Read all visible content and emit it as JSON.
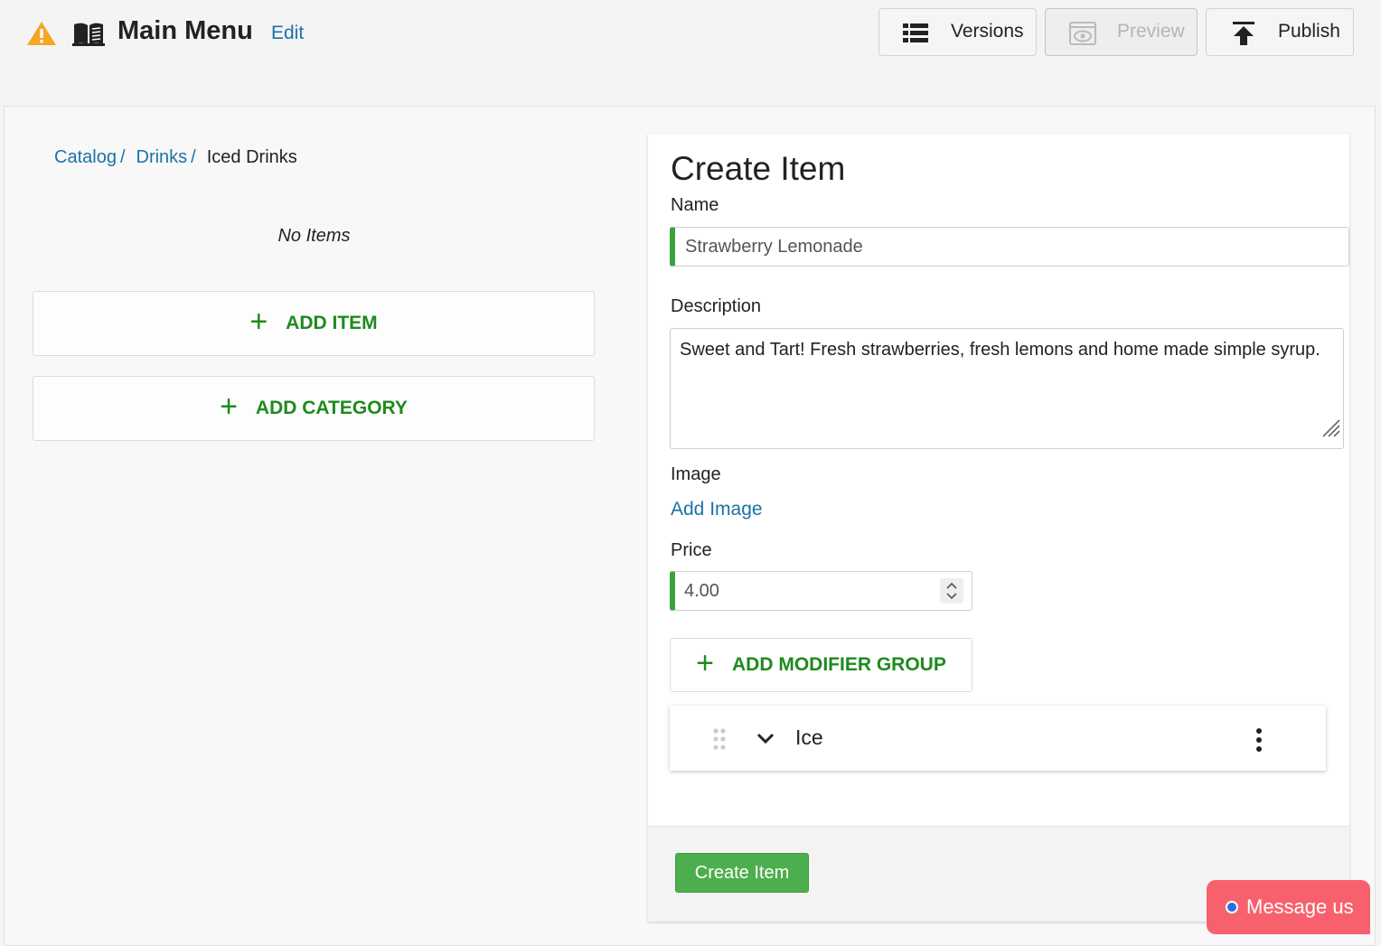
{
  "header": {
    "title": "Main Menu",
    "edit_label": "Edit",
    "versions_label": "Versions",
    "preview_label": "Preview",
    "publish_label": "Publish"
  },
  "breadcrumb": {
    "items": [
      "Catalog",
      "Drinks"
    ],
    "separator": "/",
    "current": "Iced Drinks"
  },
  "left_panel": {
    "empty_text": "No Items",
    "add_item_label": "ADD ITEM",
    "add_category_label": "ADD CATEGORY"
  },
  "form": {
    "title": "Create Item",
    "name_label": "Name",
    "name_value": "Strawberry Lemonade",
    "description_label": "Description",
    "description_value": "Sweet and Tart! Fresh strawberries, fresh lemons and home made simple syrup.",
    "image_label": "Image",
    "add_image_label": "Add Image",
    "price_label": "Price",
    "price_value": "4.00",
    "add_modifier_group_label": "ADD MODIFIER GROUP",
    "modifier_groups": [
      {
        "name": "Ice"
      }
    ],
    "submit_label": "Create Item"
  },
  "chat_widget": {
    "label": "Message us"
  },
  "colors": {
    "accent_green": "#1e8a1e",
    "link_blue": "#1a73a8",
    "submit_green": "#4cae4c",
    "warning_orange": "#f5a623",
    "chat_red": "#f7616e"
  },
  "icons": [
    "warning-icon",
    "book-icon",
    "list-icon",
    "eye-icon",
    "upload-icon",
    "plus-icon",
    "drag-handle-icon",
    "chevron-down-icon",
    "more-vertical-icon",
    "resize-grip-icon"
  ]
}
